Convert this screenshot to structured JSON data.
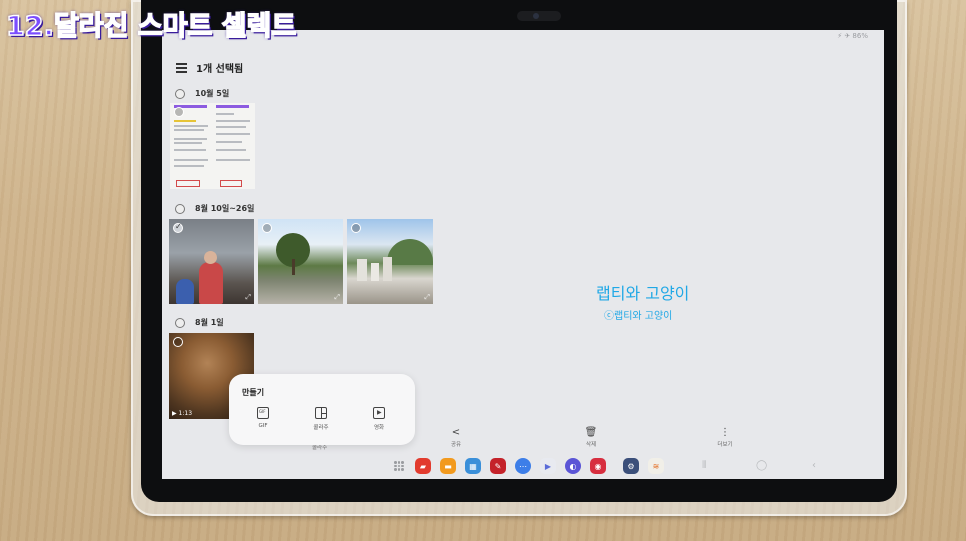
{
  "overlay": {
    "video_title": "12.달라진 스마트 셀렉트"
  },
  "screen": {
    "status_text": "⚡ ✈ 86%",
    "header": {
      "title": "1개 선택됨"
    },
    "groups": [
      {
        "date": "10월 5일"
      },
      {
        "date": "8월 10일~26일"
      },
      {
        "date": "8월 1일"
      }
    ],
    "video_duration": "1:13",
    "watermark": {
      "main": "랩티와 고양이",
      "sub": "ⓒ랩티와 고양이"
    },
    "make_popup": {
      "title": "만들기",
      "items": [
        {
          "label": "GIF",
          "icon": "gif-icon"
        },
        {
          "label": "콜라주",
          "icon": "collage-icon"
        },
        {
          "label": "영화",
          "icon": "movie-icon"
        }
      ]
    },
    "actions": [
      {
        "label": "공유",
        "icon": "share-icon"
      },
      {
        "label": "삭제",
        "icon": "trash-icon"
      },
      {
        "label": "더보기",
        "icon": "more-vertical-icon"
      }
    ],
    "behind_label": "콜라주",
    "dock_apps": [
      {
        "icon": "app-icon",
        "color": "#e23b2e"
      },
      {
        "icon": "folder-icon",
        "color": "#f29a1e"
      },
      {
        "icon": "calendar-icon",
        "color": "#3a8fd9"
      },
      {
        "icon": "pen-icon",
        "color": "#c4222a"
      },
      {
        "icon": "messages-icon",
        "color": "#3d7ee8"
      },
      {
        "icon": "play-store-icon",
        "color": "#e8eaf0"
      },
      {
        "icon": "internet-icon",
        "color": "#5b55d6"
      },
      {
        "icon": "camera-icon",
        "color": "#d72e3f"
      },
      {
        "icon": "settings-icon",
        "color": "#3b4f7a"
      },
      {
        "icon": "swift-icon",
        "color": "#f1efe8"
      }
    ]
  }
}
